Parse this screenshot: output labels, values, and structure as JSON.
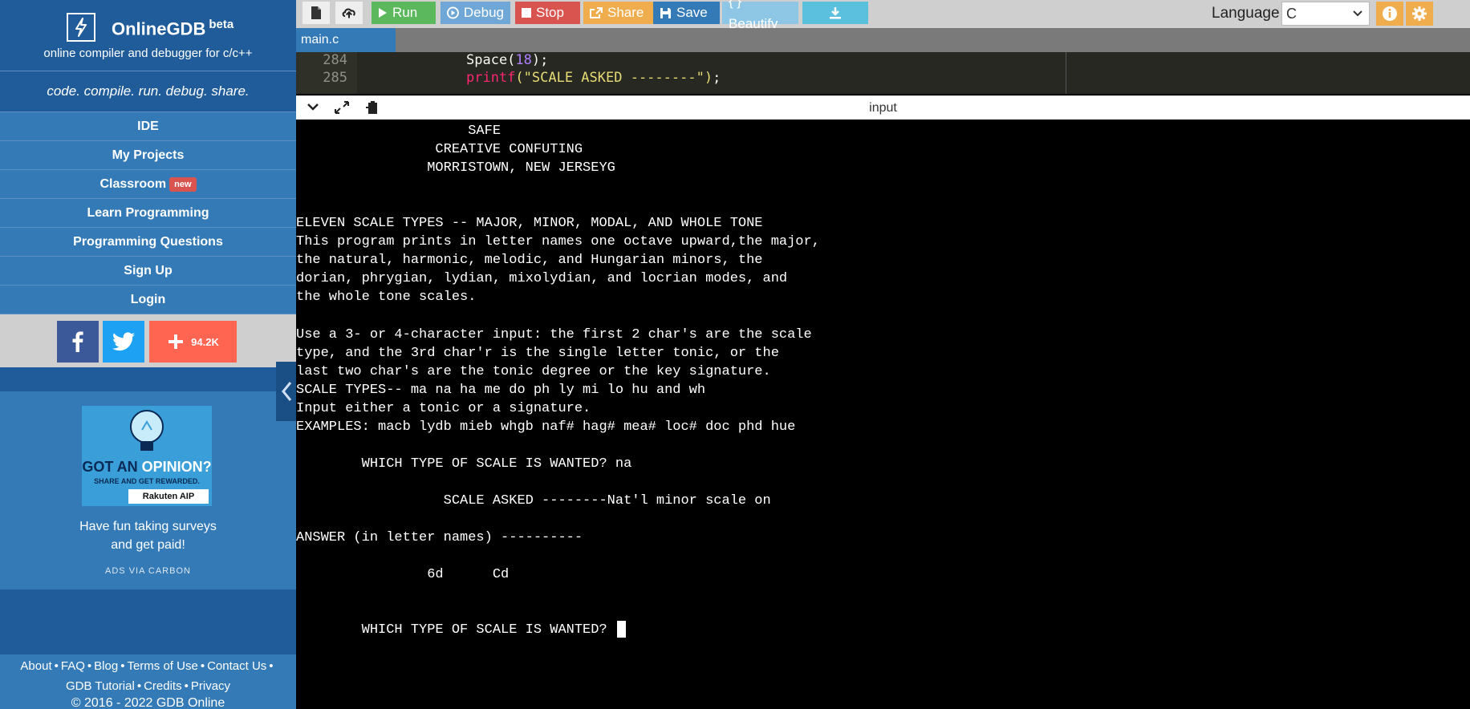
{
  "sidebar": {
    "brand": "OnlineGDB",
    "brand_sup": "beta",
    "tagline": "online compiler and debugger for c/c++",
    "motto": "code. compile. run. debug. share.",
    "nav": [
      "IDE",
      "My Projects",
      "Classroom",
      "Learn Programming",
      "Programming Questions",
      "Sign Up",
      "Login"
    ],
    "classroom_badge": "new",
    "share_count": "94.2K",
    "ad": {
      "headline_a": "GOT AN ",
      "headline_b": "OPINION?",
      "sub": "SHARE AND GET REWARDED.",
      "brand": "Rakuten AIP",
      "text_1": "Have fun taking surveys",
      "text_2": "and get paid!",
      "via": "ADS VIA CARBON"
    },
    "footer": {
      "links1": [
        "About",
        "FAQ",
        "Blog",
        "Terms of Use",
        "Contact Us"
      ],
      "links2": [
        "GDB Tutorial",
        "Credits",
        "Privacy"
      ],
      "copyright": "© 2016 - 2022 GDB Online"
    }
  },
  "toolbar": {
    "run": "Run",
    "debug": "Debug",
    "stop": "Stop",
    "share": "Share",
    "save": "Save",
    "beautify": "{ } Beautify",
    "language_label": "Language",
    "language_value": "C"
  },
  "file_tab": "main.c",
  "editor": {
    "lines": [
      {
        "num": "284",
        "a": "Space(",
        "b": "18",
        "c": ");"
      },
      {
        "num": "285",
        "a": "printf",
        "b": "(\"SCALE ASKED --------\")",
        "c": ";"
      }
    ]
  },
  "io": {
    "title": "input"
  },
  "console": {
    "lines": [
      "                     SAFE",
      "                 CREATIVE CONFUTING",
      "                MORRISTOWN, NEW JERSEYG",
      "",
      "",
      "ELEVEN SCALE TYPES -- MAJOR, MINOR, MODAL, AND WHOLE TONE",
      "This program prints in letter names one octave upward,the major,",
      "the natural, harmonic, melodic, and Hungarian minors, the",
      "dorian, phrygian, lydian, mixolydian, and locrian modes, and",
      "the whole tone scales.",
      "",
      "Use a 3- or 4-character input: the first 2 char's are the scale",
      "type, and the 3rd char'r is the single letter tonic, or the",
      "last two char's are the tonic degree or the key signature.",
      "SCALE TYPES-- ma na ha me do ph ly mi lo hu and wh",
      "Input either a tonic or a signature.",
      "EXAMPLES: macb lydb mieb whgb naf# hag# mea# loc# doc phd hue",
      "",
      "        WHICH TYPE OF SCALE IS WANTED? na",
      "",
      "                  SCALE ASKED --------Nat'l minor scale on",
      "",
      "ANSWER (in letter names) ----------",
      "",
      "                6d      Cd",
      "",
      "",
      "        WHICH TYPE OF SCALE IS WANTED? "
    ]
  }
}
